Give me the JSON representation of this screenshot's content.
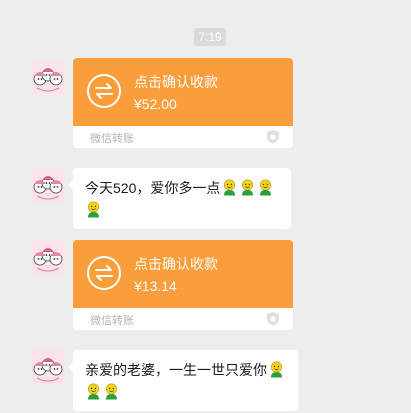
{
  "chat": {
    "time": "7:19",
    "messages": [
      {
        "type": "transfer",
        "title": "点击确认收款",
        "amount": "¥52.00",
        "footer": "微信转账"
      },
      {
        "type": "text",
        "text": "今天520，爱你多一点",
        "emoji": "smiley-emoji"
      },
      {
        "type": "transfer",
        "title": "点击确认收款",
        "amount": "¥13.14",
        "footer": "微信转账"
      },
      {
        "type": "text",
        "text": "亲爱的老婆，一生一世只爱你",
        "emoji": "smiley-emoji"
      }
    ]
  },
  "colors": {
    "background": "#ededed",
    "transfer_orange": "#fa9d3b",
    "bubble_white": "#ffffff",
    "footer_gray": "#b2b2b2"
  }
}
